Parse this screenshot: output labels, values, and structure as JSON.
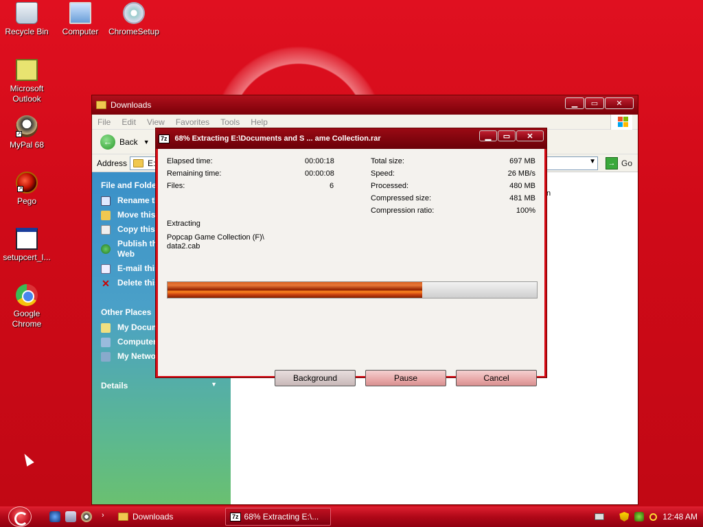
{
  "desktop": {
    "icons": [
      {
        "label": "Recycle Bin"
      },
      {
        "label": "Computer"
      },
      {
        "label": "ChromeSetup"
      },
      {
        "label": "Microsoft Outlook"
      },
      {
        "label": "MyPal 68"
      },
      {
        "label": "Pego"
      },
      {
        "label": "setupcert_I..."
      },
      {
        "label": "Google Chrome"
      }
    ]
  },
  "explorer": {
    "title": "Downloads",
    "menu": [
      "File",
      "Edit",
      "View",
      "Favorites",
      "Tools",
      "Help"
    ],
    "toolbar": {
      "back_label": "Back"
    },
    "address": {
      "label": "Address",
      "value": "E:\\",
      "go_label": "Go"
    },
    "file_folder_tasks": {
      "title": "File and Folder",
      "items": [
        "Rename th",
        "Move this",
        "Copy this",
        "Publish th Web",
        "E-mail this",
        "Delete this"
      ]
    },
    "other_places": {
      "title": "Other Places",
      "items": [
        "My Docum",
        "Computer",
        "My Netwo"
      ]
    },
    "details": {
      "title": "Details"
    },
    "content_fragment": "n"
  },
  "dialog": {
    "title": "68% Extracting E:\\Documents and S ... ame Collection.rar",
    "app_badge": "7z",
    "stats_left": [
      {
        "label": "Elapsed time:",
        "value": "00:00:18"
      },
      {
        "label": "Remaining time:",
        "value": "00:00:08"
      },
      {
        "label": "Files:",
        "value": "6"
      }
    ],
    "stats_right": [
      {
        "label": "Total size:",
        "value": "697 MB"
      },
      {
        "label": "Speed:",
        "value": "26 MB/s"
      },
      {
        "label": "Processed:",
        "value": "480 MB"
      },
      {
        "label": "Compressed size:",
        "value": "481 MB"
      },
      {
        "label": "Compression ratio:",
        "value": "100%"
      }
    ],
    "status_label": "Extracting",
    "current_file_line1": "Popcap Game Collection (F)\\",
    "current_file_line2": "data2.cab",
    "progress_percent": 69,
    "buttons": {
      "background": "Background",
      "pause": "Pause",
      "cancel": "Cancel"
    }
  },
  "taskbar": {
    "items": [
      {
        "label": "Downloads"
      },
      {
        "label": "68% Extracting E:\\..."
      }
    ],
    "app_badge": "7z",
    "clock": "12:48 AM"
  }
}
